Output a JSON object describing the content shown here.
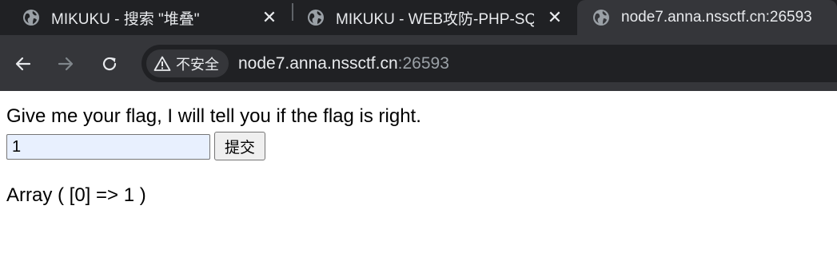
{
  "browser": {
    "tabs": [
      {
        "title": "MIKUKU - 搜索 \"堆叠\"",
        "close_label": "✕",
        "active": false
      },
      {
        "title": "MIKUKU - WEB攻防-PHP-SQL",
        "close_label": "✕",
        "active": false
      },
      {
        "title": "node7.anna.nssctf.cn:26593",
        "active": true
      }
    ],
    "toolbar": {
      "security_label": "不安全",
      "url_host": "node7.anna.nssctf.cn",
      "url_port": ":26593"
    }
  },
  "page": {
    "prompt": "Give me your flag, I will tell you if the flag is right.",
    "input_value": "1",
    "submit_label": "提交",
    "result": "Array ( [0] => 1 )"
  },
  "colors": {
    "tabstrip_bg": "#202124",
    "toolbar_bg": "#35363a",
    "input_autofill_bg": "#e8f0fe"
  }
}
